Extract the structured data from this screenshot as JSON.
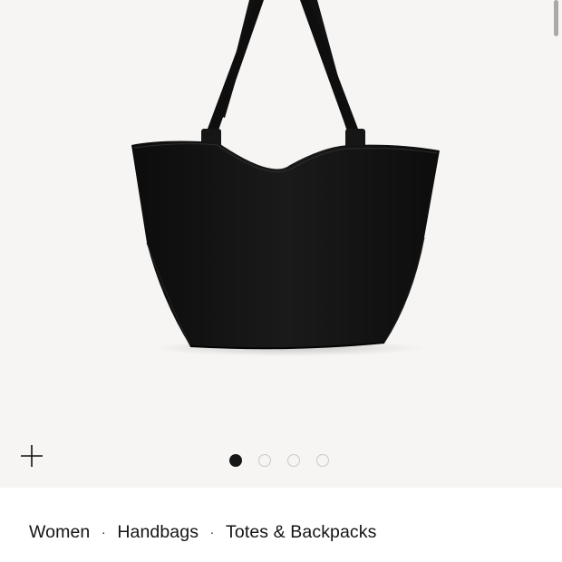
{
  "gallery": {
    "image_icon": "black-leather-tote-bag-image",
    "zoom_icon": "plus-icon",
    "slide_count": 4,
    "active_slide": 1,
    "colors": {
      "background": "#f6f5f3",
      "active_dot": "#161616",
      "inactive_dot": "#c9c9c9"
    }
  },
  "breadcrumb": {
    "separator": "·",
    "items": [
      "Women",
      "Handbags",
      "Totes & Backpacks"
    ]
  }
}
